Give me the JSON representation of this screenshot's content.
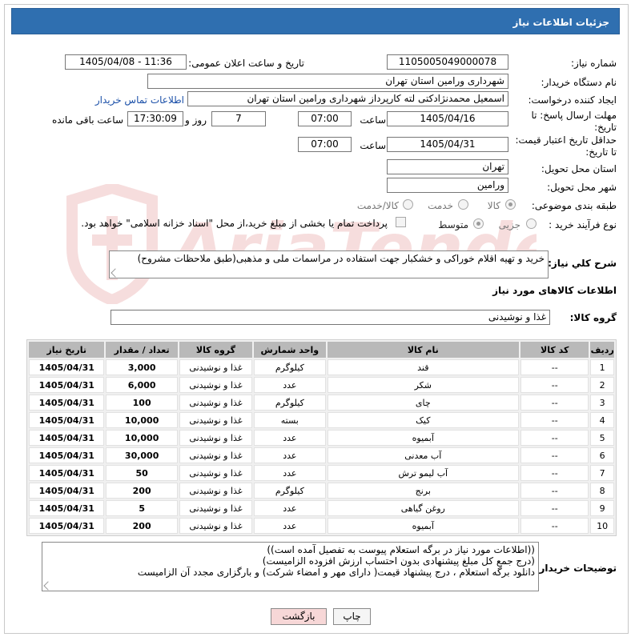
{
  "window": {
    "title": "جزئیات اطلاعات نیاز"
  },
  "form": {
    "need_number_label": "شماره نیاز:",
    "need_number": "1105005049000078",
    "announce_label": "تاریخ و ساعت اعلان عمومی:",
    "announce_value": "1405/04/08 - 11:36",
    "buyer_org_label": "نام دستگاه خریدار:",
    "buyer_org": "شهرداری ورامین استان تهران",
    "creator_label": "ایجاد کننده درخواست:",
    "creator": "اسمعیل محمدنژادکتی لته کارپرداز شهرداری ورامین استان تهران",
    "contact_link": "اطلاعات تماس خریدار",
    "deadline_label_1": "مهلت ارسال پاسخ: تا",
    "deadline_label_2": "تاریخ:",
    "deadline_date": "1405/04/16",
    "time_label": "ساعت",
    "deadline_time": "07:00",
    "days_value": "7",
    "days_label": "روز و",
    "remaining_value": "17:30:09",
    "remaining_label": "ساعت باقی مانده",
    "validity_label_1": "حداقل تاریخ اعتبار قیمت:",
    "validity_label_2": "تا تاریخ:",
    "validity_date": "1405/04/31",
    "validity_time": "07:00",
    "province_label": "استان محل تحویل:",
    "province": "تهران",
    "city_label": "شهر محل تحویل:",
    "city": "ورامین",
    "category_label": "طبقه بندی موضوعی:",
    "category_options": [
      "کالا",
      "خدمت",
      "کالا/خدمت"
    ],
    "category_selected": "کالا",
    "process_label": "نوع فرآیند خرید :",
    "process_options": [
      "جزیی",
      "متوسط"
    ],
    "process_selected": "متوسط",
    "payment_note": "پرداخت تمام یا بخشی از مبلغ خرید،از محل \"اسناد خزانه اسلامی\" خواهد بود."
  },
  "description": {
    "label": "شرح كلي نياز:",
    "text": "خرید و تهیه اقلام خوراکی و خشکبار جهت استفاده در مراسمات ملی و مذهبی(طبق ملاحظات مشروح)"
  },
  "goods": {
    "section_title": "اطلاعات کالاهای مورد نیاز",
    "group_label": "گروه کالا:",
    "group_value": "غذا و نوشیدنی",
    "columns": [
      "ردیف",
      "کد کالا",
      "نام کالا",
      "واحد شمارش",
      "گروه کالا",
      "تعداد / مقدار",
      "تاریخ نیاز"
    ],
    "rows": [
      [
        "1",
        "--",
        "قند",
        "کیلوگرم",
        "غذا و نوشیدنی",
        "3,000",
        "1405/04/31"
      ],
      [
        "2",
        "--",
        "شکر",
        "عدد",
        "غذا و نوشیدنی",
        "6,000",
        "1405/04/31"
      ],
      [
        "3",
        "--",
        "چای",
        "کیلوگرم",
        "غذا و نوشیدنی",
        "100",
        "1405/04/31"
      ],
      [
        "4",
        "--",
        "کیک",
        "بسته",
        "غذا و نوشیدنی",
        "10,000",
        "1405/04/31"
      ],
      [
        "5",
        "--",
        "آبمیوه",
        "عدد",
        "غذا و نوشیدنی",
        "10,000",
        "1405/04/31"
      ],
      [
        "6",
        "--",
        "آب معدنی",
        "عدد",
        "غذا و نوشیدنی",
        "30,000",
        "1405/04/31"
      ],
      [
        "7",
        "--",
        "آب لیمو ترش",
        "عدد",
        "غذا و نوشیدنی",
        "50",
        "1405/04/31"
      ],
      [
        "8",
        "--",
        "برنج",
        "کیلوگرم",
        "غذا و نوشیدنی",
        "200",
        "1405/04/31"
      ],
      [
        "9",
        "--",
        "روغن گیاهی",
        "عدد",
        "غذا و نوشیدنی",
        "5",
        "1405/04/31"
      ],
      [
        "10",
        "--",
        "آبمیوه",
        "عدد",
        "غذا و نوشیدنی",
        "200",
        "1405/04/31"
      ]
    ]
  },
  "buyer_notes": {
    "label": "توضیحات خریدار:",
    "lines": [
      "((اطلاعات مورد نیاز در برگه استعلام پیوست به تفصیل آمده است))",
      "(درج  جمع کل مبلغ پیشنهادی بدون احتساب ارزش افزوده الزامیست)",
      "دانلود برگه استعلام ، درج پیشنهاد قیمت( دارای مهر و امضاء شرکت) و بارگزاری مجدد آن الزامیست"
    ]
  },
  "buttons": {
    "print": "چاپ",
    "back": "بازگشت"
  },
  "watermark_text": "AriaTender.net",
  "colors": {
    "titlebar": "#2f6fb0",
    "link": "#1a4fa8",
    "back_button": "#f7d7d7",
    "table_header": "#b9b9b9"
  }
}
